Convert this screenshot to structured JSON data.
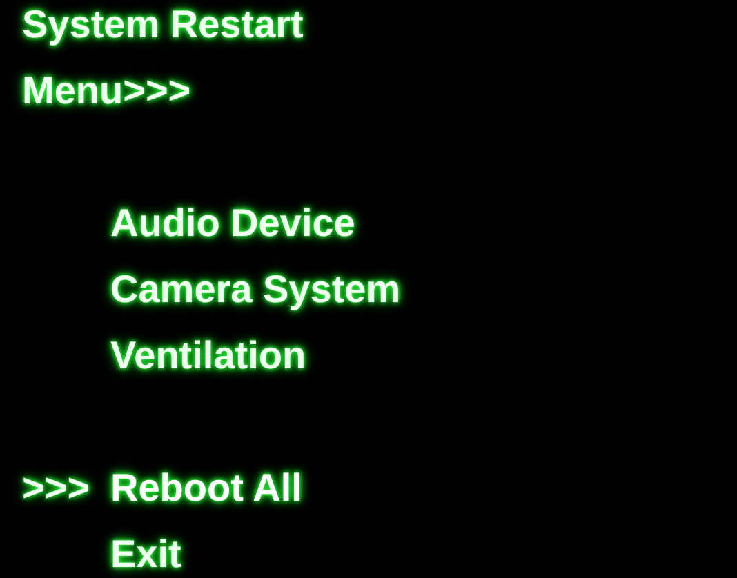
{
  "title": "System Restart",
  "menu_label": "Menu>>>",
  "cursor": ">>>",
  "sections": [
    {
      "items": [
        {
          "label": "Audio Device",
          "selected": false
        },
        {
          "label": "Camera System",
          "selected": false
        },
        {
          "label": "Ventilation",
          "selected": false
        }
      ]
    },
    {
      "items": [
        {
          "label": "Reboot All",
          "selected": true
        },
        {
          "label": "Exit",
          "selected": false
        }
      ]
    }
  ]
}
